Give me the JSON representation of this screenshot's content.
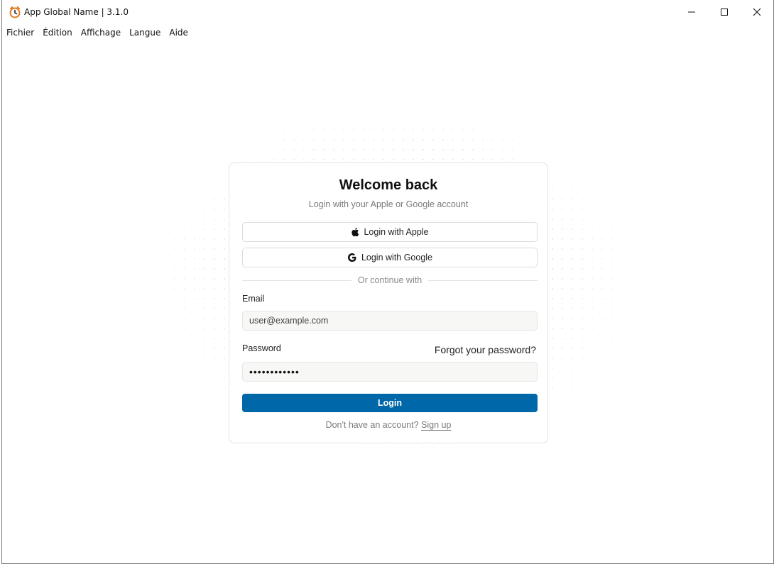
{
  "window": {
    "title": "App Global Name | 3.1.0",
    "icon": "alarm-clock-icon",
    "controls": [
      "minimize-icon",
      "maximize-icon",
      "close-icon"
    ]
  },
  "menubar": {
    "items": [
      "Fichier",
      "Édition",
      "Affichage",
      "Langue",
      "Aide"
    ]
  },
  "login": {
    "title": "Welcome back",
    "subtitle": "Login with your Apple or Google account",
    "apple_button": "Login with Apple",
    "google_button": "Login with Google",
    "divider": "Or continue with",
    "email_label": "Email",
    "email_value": "user@example.com",
    "password_label": "Password",
    "forgot_link": "Forgot your password?",
    "password_value": "••••••••••••",
    "login_button": "Login",
    "signup_prompt": "Don't have an account?",
    "signup_link": "Sign up"
  },
  "colors": {
    "primary": "#0067a8",
    "app_icon_accent": "#e07a1f"
  }
}
